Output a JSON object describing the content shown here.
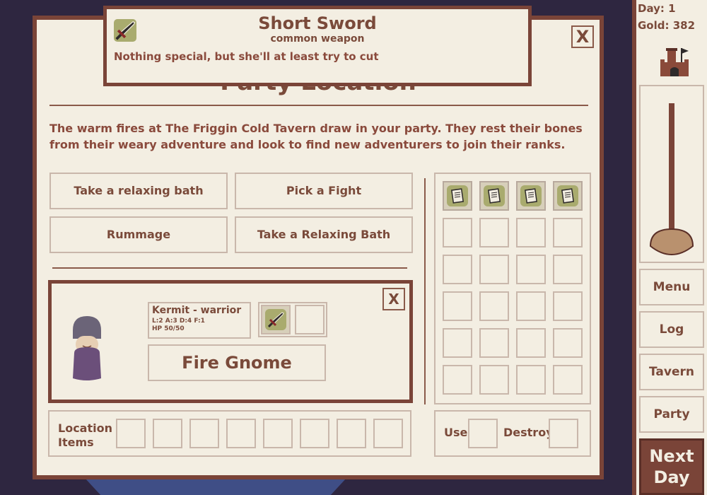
{
  "tooltip": {
    "item_name": "Short Sword",
    "item_type": "common weapon",
    "item_description": "Nothing special, but she'll at least try to cut",
    "icon": "sword-icon"
  },
  "panel": {
    "title": "Party Location",
    "close_label": "X",
    "description": "The warm fires at The Friggin Cold Tavern draw in your party. They rest their bones from their weary adventure and look to find new adventurers to join their ranks.",
    "actions": [
      "Take a relaxing bath",
      "Pick a Fight",
      "Rummage",
      "Take a Relaxing Bath"
    ]
  },
  "character": {
    "name_class": "Kermit - warrior",
    "stats": "L:2 A:3 D:4 F:1",
    "hp": "HP 50/50",
    "class_name": "Fire Gnome",
    "close_label": "X",
    "equipped_icon": "sword-icon"
  },
  "location_items": {
    "label": "Location Items",
    "slot_count": 8
  },
  "inventory": {
    "filled_icons": [
      "scroll-icon",
      "scroll-icon",
      "scroll-icon",
      "scroll-icon"
    ],
    "rows": 6,
    "cols": 4
  },
  "item_actions": {
    "use_label": "Use",
    "destroy_label": "Destroy"
  },
  "sidebar": {
    "day": "Day: 1",
    "gold": "Gold: 382",
    "buttons": [
      "Menu",
      "Log",
      "Tavern",
      "Party"
    ],
    "next_day": "Next Day"
  },
  "colors": {
    "panel_bg": "#f3eee2",
    "border_dark": "#7a4438",
    "border_light": "#c9b7ab",
    "text": "#7a4a3a",
    "item_bg": "#a9ab6e",
    "backdrop": "#2e2640"
  }
}
